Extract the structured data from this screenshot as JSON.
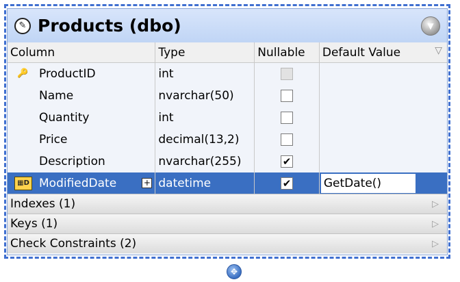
{
  "entity": {
    "title": "Products (dbo)",
    "title_icon": "pencil-circle-icon",
    "collapse_icon": "chevron-down-icon"
  },
  "columns_header": {
    "column": "Column",
    "type": "Type",
    "nullable": "Nullable",
    "default_value": "Default Value",
    "filter_icon": "filter-triangle-icon"
  },
  "rows": [
    {
      "name": "ProductID",
      "type": "int",
      "nullable": false,
      "nullable_disabled": true,
      "default": "",
      "icon": "primary-key-icon",
      "selected": false
    },
    {
      "name": "Name",
      "type": "nvarchar(50)",
      "nullable": false,
      "nullable_disabled": false,
      "default": "",
      "icon": "",
      "selected": false
    },
    {
      "name": "Quantity",
      "type": "int",
      "nullable": false,
      "nullable_disabled": false,
      "default": "",
      "icon": "",
      "selected": false
    },
    {
      "name": "Price",
      "type": "decimal(13,2)",
      "nullable": false,
      "nullable_disabled": false,
      "default": "",
      "icon": "",
      "selected": false
    },
    {
      "name": "Description",
      "type": "nvarchar(255)",
      "nullable": true,
      "nullable_disabled": false,
      "default": "",
      "icon": "",
      "selected": false
    },
    {
      "name": "ModifiedDate",
      "type": "datetime",
      "nullable": true,
      "nullable_disabled": false,
      "default": "GetDate()",
      "icon": "date-column-icon",
      "selected": true
    }
  ],
  "sections": [
    {
      "label": "Indexes (1)"
    },
    {
      "label": "Keys (1)"
    },
    {
      "label": "Check Constraints (2)"
    }
  ],
  "colors": {
    "selection": "#3a6fc2",
    "frame": "#3f6fd0",
    "header_gradient_top": "#d8e5fb"
  }
}
